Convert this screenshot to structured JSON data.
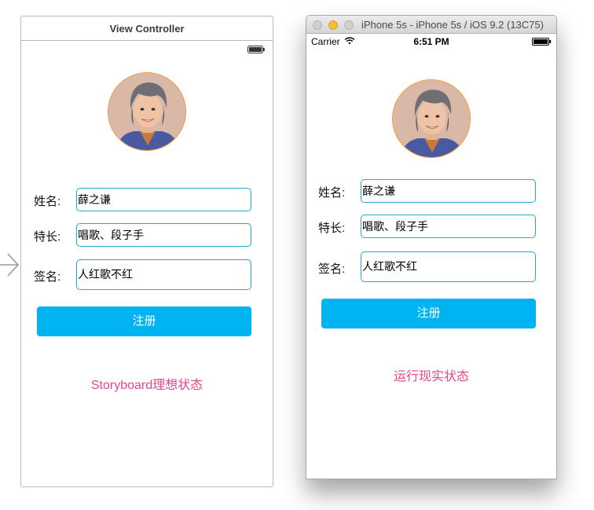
{
  "storyboard": {
    "scene_title": "View Controller",
    "avatar": "portrait-avatar",
    "fields": [
      {
        "label": "姓名:",
        "value": "薛之谦"
      },
      {
        "label": "特长:",
        "value": "唱歌、段子手"
      },
      {
        "label": "签名:",
        "value": "人红歌不红"
      }
    ],
    "register_label": "注册",
    "caption": "Storyboard理想状态"
  },
  "simulator": {
    "window_title": "iPhone 5s - iPhone 5s / iOS 9.2 (13C75)",
    "status_bar": {
      "carrier": "Carrier",
      "time": "6:51 PM"
    },
    "avatar": "portrait-avatar",
    "fields": [
      {
        "label": "姓名:",
        "value": "薛之谦"
      },
      {
        "label": "特长:",
        "value": "唱歌、段子手"
      },
      {
        "label": "签名:",
        "value": "人红歌不红"
      }
    ],
    "register_label": "注册",
    "caption": "运行现实状态"
  },
  "colors": {
    "accent_button": "#00b4f2",
    "input_border": "#26a8d6",
    "caption_pink": "#e5468b",
    "avatar_border": "#f0922c"
  },
  "icons": [
    "entry-arrow-icon",
    "battery-icon",
    "wifi-icon",
    "close-window-icon",
    "minimize-window-icon",
    "maximize-window-icon"
  ]
}
